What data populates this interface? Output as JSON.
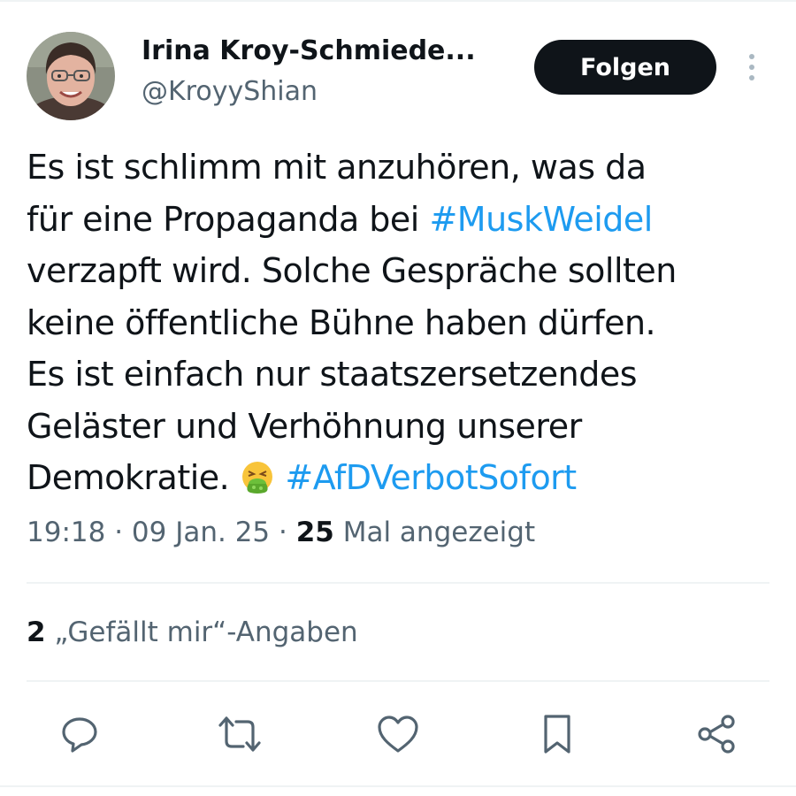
{
  "author": {
    "display_name": "Irina Kroy-Schmiede...",
    "handle": "@KroyyShian",
    "avatar": "avatar-photo"
  },
  "follow_button": {
    "label": "Folgen"
  },
  "more_menu": {
    "icon": "more-vertical-icon"
  },
  "tweet": {
    "lines": [
      "Es ist schlimm mit anzuhören, was da",
      "für eine Propaganda bei ",
      "verzapft wird. Solche Gespräche sollten",
      "keine öffentliche Bühne haben dürfen.",
      "Es ist einfach nur staatszersetzendes",
      "Geläster und Verhöhnung unserer",
      "Demokratie. "
    ],
    "hashtags": [
      "#MuskWeidel",
      "#AfDVerbotSofort"
    ],
    "emoji": "face-vomiting-emoji"
  },
  "meta": {
    "time": "19:18",
    "separator": " · ",
    "date": "09 Jan. 25",
    "views_count": "25",
    "views_label": " Mal angezeigt"
  },
  "likes": {
    "count": "2",
    "label": " „Gefällt mir“-Angaben"
  },
  "actions": [
    {
      "name": "reply",
      "icon": "reply-icon"
    },
    {
      "name": "retweet",
      "icon": "retweet-icon"
    },
    {
      "name": "like",
      "icon": "heart-icon"
    },
    {
      "name": "bookmark",
      "icon": "bookmark-icon"
    },
    {
      "name": "share",
      "icon": "share-icon"
    }
  ],
  "colors": {
    "text": "#0f1419",
    "secondary": "#536471",
    "link": "#1d9bf0",
    "divider": "#eff3f4",
    "button_bg": "#0f1419"
  }
}
